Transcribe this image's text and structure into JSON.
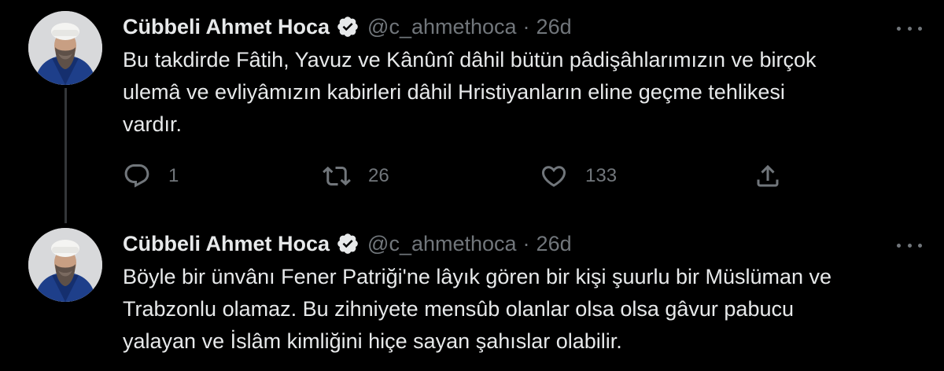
{
  "tweets": [
    {
      "author": {
        "name": "Cübbeli Ahmet Hoca",
        "handle": "@c_ahmethoca",
        "verified": true,
        "avatar_icon": "profile-photo"
      },
      "separator": "·",
      "time": "26d",
      "text_lines": [
        "Bu takdirde Fâtih, Yavuz ve Kânûnî dâhil bütün pâdişâhlarımızın ve birçok",
        "ulemâ ve evliyâmızın kabirleri dâhil Hristiyanların eline geçme tehlikesi",
        "vardır."
      ],
      "stats": {
        "replies": "1",
        "retweets": "26",
        "likes": "133"
      }
    },
    {
      "author": {
        "name": "Cübbeli Ahmet Hoca",
        "handle": "@c_ahmethoca",
        "verified": true,
        "avatar_icon": "profile-photo"
      },
      "separator": "·",
      "time": "26d",
      "text_lines": [
        "Böyle bir ünvânı Fener Patriği'ne lâyık gören bir kişi şuurlu bir Müslüman ve",
        "Trabzonlu olamaz. Bu zihniyete mensûb olanlar olsa olsa gâvur pabucu",
        "yalayan ve İslâm kimliğini hiçe sayan şahıslar olabilir."
      ]
    }
  ],
  "icons": {
    "reply": "speech-bubble-icon",
    "retweet": "retweet-arrows-icon",
    "like": "heart-outline-icon",
    "share": "share-upload-icon",
    "more": "more-dots-icon",
    "verified": "verified-badge-icon"
  },
  "colors": {
    "background": "#000000",
    "primary_text": "#e7e9ea",
    "secondary_text": "#71767b",
    "thread_line": "#333639",
    "verified_badge": "#e7e9ea"
  }
}
